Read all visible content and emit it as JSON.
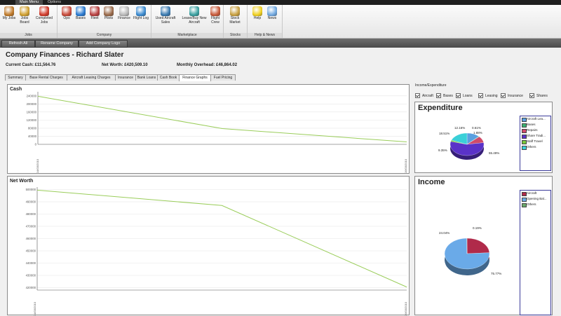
{
  "menu_tabs": [
    "Main Menu",
    "Options"
  ],
  "ribbon": {
    "groups": [
      {
        "label": "Jobs",
        "buttons": [
          {
            "label": "My Jobs",
            "icon": "briefcase-icon",
            "color": "#c07a2a"
          },
          {
            "label": "Jobs Board",
            "icon": "jobs-board-icon",
            "color": "#d0a030"
          },
          {
            "label": "Completed Jobs",
            "icon": "checkmark-icon",
            "color": "#d03a2a"
          }
        ]
      },
      {
        "label": "Company",
        "buttons": [
          {
            "label": "Ops",
            "icon": "ops-person-icon",
            "color": "#c84a3a"
          },
          {
            "label": "Bases",
            "icon": "globe-icon",
            "color": "#2a7ad0"
          },
          {
            "label": "Fleet",
            "icon": "airplane-icon",
            "color": "#b84040"
          },
          {
            "label": "Pilots",
            "icon": "pilot-icon",
            "color": "#9a6a4a"
          },
          {
            "label": "Finance",
            "icon": "finance-icon",
            "color": "#b8b8b8"
          },
          {
            "label": "Flight Log",
            "icon": "logbook-icon",
            "color": "#3a8ad0"
          }
        ]
      },
      {
        "label": "Marketplace",
        "buttons": [
          {
            "label": "Used Aircraft Sales",
            "icon": "used-aircraft-icon",
            "color": "#3a7ab0"
          },
          {
            "label": "Lease/Buy New Aircraft",
            "icon": "lease-buy-icon",
            "color": "#3aa0a0"
          },
          {
            "label": "Flight Crew",
            "icon": "flight-crew-icon",
            "color": "#c85a3a"
          }
        ]
      },
      {
        "label": "Stocks",
        "buttons": [
          {
            "label": "Stock Market",
            "icon": "stock-market-icon",
            "color": "#c8a040"
          }
        ]
      },
      {
        "label": "Help & News",
        "buttons": [
          {
            "label": "Help",
            "icon": "lightbulb-icon",
            "color": "#f0d020"
          },
          {
            "label": "News",
            "icon": "news-icon",
            "color": "#70a8e0"
          }
        ]
      }
    ]
  },
  "toolbar": {
    "refresh_all": "Refresh All",
    "rename_company": "Rename Company",
    "add_company_logo": "Add Company Logo"
  },
  "page": {
    "title": "Company Finances - Richard Slater",
    "current_cash": "Current Cash: £11,564.76",
    "net_worth": "Net Worth: £420,509.10",
    "monthly_overhead": "Monthly Overhead: £46,864.02"
  },
  "tabs": [
    "Summary",
    "Base Rental Charges",
    "Aircraft Leasing Charges",
    "Insurance",
    "Bank Loans",
    "Cash Book",
    "Finance Graphs",
    "Fuel Pricing"
  ],
  "active_tab": "Finance Graphs",
  "cash_chart": {
    "title": "Cash",
    "y_ticks": [
      "240000",
      "200000",
      "160000",
      "120000",
      "80000",
      "40000",
      "0"
    ],
    "x_start_label": "14/03/2010",
    "x_end_label": "16/03/2010"
  },
  "networth_chart": {
    "title": "Net Worth",
    "y_ticks": [
      "500000",
      "490000",
      "480000",
      "470000",
      "460000",
      "450000",
      "440000",
      "430000",
      "420000"
    ],
    "x_start_label": "14/03/2010",
    "x_end_label": "16/03/2010"
  },
  "income_expenditure": {
    "label": "Income/Expenditure",
    "checkboxes": [
      "Aircraft",
      "Bases",
      "Loans",
      "Leasing",
      "Insurance",
      "Shares"
    ]
  },
  "expenditure": {
    "title": "Expenditure",
    "legend": [
      "Aircraft Lea...",
      "Bases",
      "Repairs",
      "Share Tradi...",
      "Staff Travel",
      "Others"
    ],
    "labels": [
      "12.16%",
      "0.61%",
      "1.88%",
      "18.51%",
      "9.35%",
      "55.49%"
    ]
  },
  "income": {
    "title": "Income",
    "legend": [
      "Aircraft",
      "Opening Bal...",
      "Others"
    ],
    "labels": [
      "24.04%",
      "0.19%",
      "75.77%"
    ]
  },
  "colors": {
    "line": "#9acd5a",
    "aircraft_lease": "#5aa0e0",
    "bases": "#3ab070",
    "repairs": "#d04a6a",
    "share_trading": "#5a32c8",
    "staff_travel": "#7ac83a",
    "others": "#3ad0d8",
    "income_aircraft": "#b02a4a",
    "income_opening": "#6aaae8",
    "income_others": "#6aa86a"
  },
  "chart_data": [
    {
      "type": "line",
      "title": "Cash",
      "x": [
        "14/03/2010",
        "15/03/2010",
        "16/03/2010"
      ],
      "series": [
        {
          "values": [
            238000,
            78000,
            12000
          ]
        }
      ],
      "ylim": [
        0,
        260000
      ]
    },
    {
      "type": "line",
      "title": "Net Worth",
      "x": [
        "14/03/2010",
        "15/03/2010",
        "16/03/2010"
      ],
      "series": [
        {
          "values": [
            499500,
            487000,
            420500
          ]
        }
      ],
      "ylim": [
        418000,
        502000
      ]
    },
    {
      "type": "pie",
      "title": "Expenditure",
      "categories": [
        "Aircraft Lea...",
        "Bases",
        "Repairs",
        "Share Tradi...",
        "Staff Travel",
        "Others"
      ],
      "values": [
        12.16,
        0.61,
        9.35,
        55.49,
        1.88,
        18.51
      ]
    },
    {
      "type": "pie",
      "title": "Income",
      "categories": [
        "Aircraft",
        "Opening Bal...",
        "Others"
      ],
      "values": [
        24.04,
        75.77,
        0.19
      ]
    }
  ]
}
